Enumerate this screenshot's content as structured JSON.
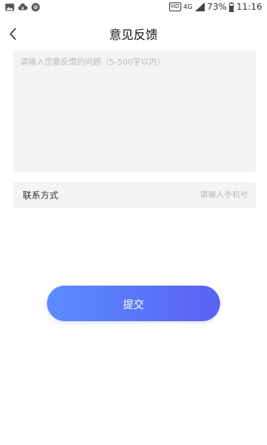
{
  "status_bar": {
    "left_icons": [
      "image-icon",
      "cloud-download-icon",
      "record-icon"
    ],
    "hd_badge": "HD",
    "network": "4G",
    "battery_percent": "73%",
    "time": "11:16"
  },
  "header": {
    "back_icon": "chevron-left-icon",
    "title": "意见反馈"
  },
  "feedback": {
    "value": "",
    "placeholder": "请输入您要反馈的问题（5-500字以内）"
  },
  "contact": {
    "label": "联系方式",
    "value": "",
    "placeholder": "请输入手机号"
  },
  "submit": {
    "label": "提交"
  },
  "colors": {
    "button_gradient_start": "#5b8cff",
    "button_gradient_end": "#5a62f2",
    "field_background": "#f4f4f4",
    "placeholder": "#b9b9b9"
  }
}
